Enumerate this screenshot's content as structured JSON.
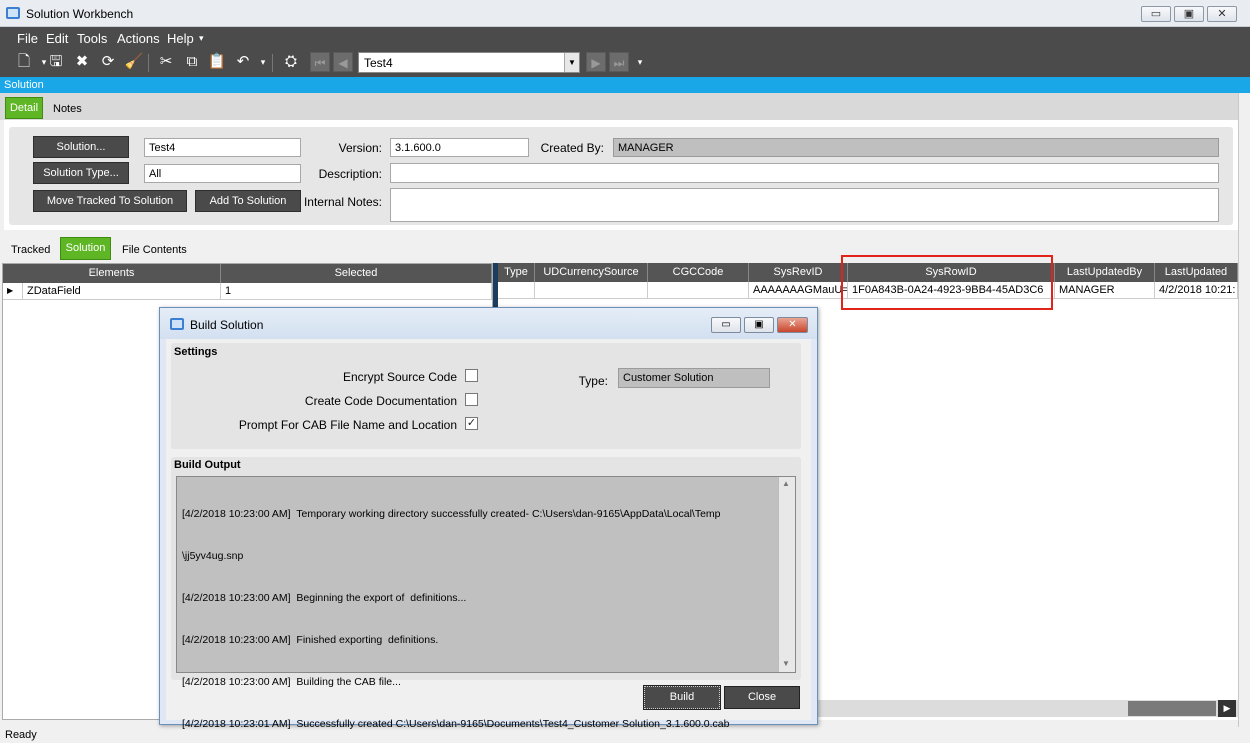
{
  "window": {
    "title": "Solution Workbench",
    "minimize": "▭",
    "restore": "▣",
    "close": "✕"
  },
  "menu": [
    "File",
    "Edit",
    "Tools",
    "Actions",
    "Help"
  ],
  "toolbar": {
    "record_value": "Test4"
  },
  "bluebar_label": "Solution",
  "top_tabs": [
    "Detail",
    "Notes"
  ],
  "detail": {
    "solution_button": "Solution...",
    "solution_value": "Test4",
    "solution_type_button": "Solution Type...",
    "solution_type_value": "All",
    "move_tracked_button": "Move Tracked To Solution",
    "add_to_solution_button": "Add To Solution",
    "version_label": "Version:",
    "version_value": "3.1.600.0",
    "created_by_label": "Created By:",
    "created_by_value": "MANAGER",
    "description_label": "Description:",
    "internal_notes_label": "Internal Notes:"
  },
  "sub_tabs": [
    "Tracked",
    "Solution",
    "File Contents"
  ],
  "left_grid": {
    "headers": [
      "Elements",
      "Selected"
    ],
    "rows": [
      {
        "elements": "ZDataField",
        "selected": "1"
      }
    ]
  },
  "right_grid": {
    "headers": [
      "Type",
      "UDCurrencySource",
      "CGCCode",
      "SysRevID",
      "SysRowID",
      "LastUpdatedBy",
      "LastUpdated"
    ],
    "rows": [
      [
        "",
        "",
        "",
        "AAAAAAAGMauU=",
        "1F0A843B-0A24-4923-9BB4-45AD3C6",
        "MANAGER",
        "4/2/2018 10:21:"
      ]
    ]
  },
  "status": "Ready",
  "dialog": {
    "title": "Build Solution",
    "settings_title": "Settings",
    "encrypt_label": "Encrypt Source Code",
    "encrypt_checked": false,
    "code_doc_label": "Create Code Documentation",
    "code_doc_checked": false,
    "prompt_cab_label": "Prompt For CAB File Name and Location",
    "prompt_cab_checked": true,
    "type_label": "Type:",
    "type_value": "Customer Solution",
    "output_title": "Build Output",
    "output_lines": [
      "[4/2/2018 10:23:00 AM]  Temporary working directory successfully created- C:\\Users\\dan-9165\\AppData\\Local\\Temp",
      "\\jj5yv4ug.snp",
      "[4/2/2018 10:23:00 AM]  Beginning the export of  definitions...",
      "[4/2/2018 10:23:00 AM]  Finished exporting  definitions.",
      "[4/2/2018 10:23:00 AM]  Building the CAB file...",
      "[4/2/2018 10:23:01 AM]  Successfully created C:\\Users\\dan-9165\\Documents\\Test4_Customer Solution_3.1.600.0.cab"
    ],
    "build_button": "Build",
    "close_button": "Close"
  }
}
